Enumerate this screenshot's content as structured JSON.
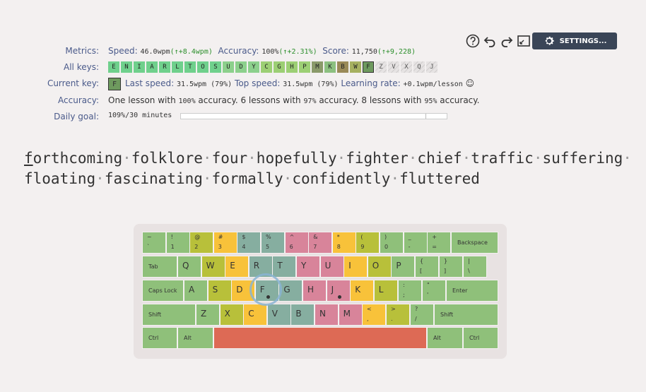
{
  "toolbar": {
    "icons": [
      "help-icon",
      "undo-icon",
      "redo-icon",
      "fullscreen-icon"
    ],
    "settings_label": "SETTINGS..."
  },
  "metrics": {
    "label": "Metrics:",
    "speed_label": "Speed:",
    "speed_value": "46.0wpm",
    "speed_delta": "(↑+8.4wpm)",
    "accuracy_label": "Accuracy:",
    "accuracy_value": "100%",
    "accuracy_delta": "(↑+2.31%)",
    "score_label": "Score:",
    "score_value": "11,750",
    "score_delta": "(↑+9,228)"
  },
  "all_keys": {
    "label": "All keys:",
    "keys": [
      {
        "k": "E",
        "color": "#6fd08c"
      },
      {
        "k": "N",
        "color": "#6fd08c"
      },
      {
        "k": "I",
        "color": "#6fd08c"
      },
      {
        "k": "A",
        "color": "#6fd08c"
      },
      {
        "k": "R",
        "color": "#6fd08c"
      },
      {
        "k": "L",
        "color": "#6fd08c"
      },
      {
        "k": "T",
        "color": "#6fd08c"
      },
      {
        "k": "O",
        "color": "#6fd08c"
      },
      {
        "k": "S",
        "color": "#6fd08c"
      },
      {
        "k": "U",
        "color": "#8cd08c"
      },
      {
        "k": "D",
        "color": "#8cd08c"
      },
      {
        "k": "Y",
        "color": "#8cd08c"
      },
      {
        "k": "C",
        "color": "#9ccf74"
      },
      {
        "k": "G",
        "color": "#9ccf74"
      },
      {
        "k": "H",
        "color": "#9ccf74"
      },
      {
        "k": "P",
        "color": "#9ccf74"
      },
      {
        "k": "M",
        "color": "#8a9a6a"
      },
      {
        "k": "K",
        "color": "#8cc080"
      },
      {
        "k": "B",
        "color": "#9a8a58"
      },
      {
        "k": "W",
        "color": "#a6b060"
      },
      {
        "k": "F",
        "color": "#6e9a5e",
        "current": true
      },
      {
        "k": "Z",
        "hatch": true
      },
      {
        "k": "V",
        "hatch": true
      },
      {
        "k": "X",
        "hatch": true
      },
      {
        "k": "Q",
        "hatch": true
      },
      {
        "k": "J",
        "hatch": true
      }
    ]
  },
  "current_key": {
    "label": "Current key:",
    "key": "F",
    "last_speed_label": "Last speed:",
    "last_speed_value": "31.5wpm (79%)",
    "top_speed_label": "Top speed:",
    "top_speed_value": "31.5wpm (79%)",
    "learning_rate_label": "Learning rate:",
    "learning_rate_value": "+0.1wpm/lesson",
    "smile": "☺"
  },
  "accuracy_row": {
    "label": "Accuracy:",
    "p1": "One lesson with ",
    "v1": "100%",
    "p2": " accuracy. 6 lessons with ",
    "v2": "97%",
    "p3": " accuracy. 8 lessons with ",
    "v3": "95%",
    "p4": " accuracy."
  },
  "daily_goal": {
    "label": "Daily goal:",
    "value": "109%/30 minutes",
    "progress": 0.92
  },
  "lesson": {
    "line1": [
      "forthcoming",
      "folklore",
      "four",
      "hopefully",
      "fighter",
      "chief",
      "traffic",
      "suffering"
    ],
    "line2": [
      "floating",
      "fascinating",
      "formally",
      "confidently",
      "fluttered"
    ],
    "separator": "·"
  },
  "keyboard": {
    "colors": {
      "green": "#8fc07a",
      "yellow": "#b8c03a",
      "orange": "#f8c23a",
      "teal": "#86aea0",
      "pink": "#d8849a",
      "space": "#dd6a55"
    },
    "row1": [
      {
        "top": "~",
        "bot": "`"
      },
      {
        "top": "!",
        "bot": "1"
      },
      {
        "top": "@",
        "bot": "2"
      },
      {
        "top": "#",
        "bot": "3"
      },
      {
        "top": "$",
        "bot": "4"
      },
      {
        "top": "%",
        "bot": "5"
      },
      {
        "top": "^",
        "bot": "6"
      },
      {
        "top": "&",
        "bot": "7"
      },
      {
        "top": "*",
        "bot": "8"
      },
      {
        "top": "(",
        "bot": "9"
      },
      {
        "top": ")",
        "bot": "0"
      },
      {
        "top": "_",
        "bot": "-"
      },
      {
        "top": "+",
        "bot": "="
      }
    ],
    "backspace": "Backspace",
    "tab": "Tab",
    "row2": [
      "Q",
      "W",
      "E",
      "R",
      "T",
      "Y",
      "U",
      "I",
      "O",
      "P"
    ],
    "row2_extra": [
      {
        "top": "{",
        "bot": "["
      },
      {
        "top": "}",
        "bot": "]"
      },
      {
        "top": "|",
        "bot": "\\"
      }
    ],
    "caps": "Caps Lock",
    "row3": [
      "A",
      "S",
      "D",
      "F",
      "G",
      "H",
      "J",
      "K",
      "L"
    ],
    "row3_extra": [
      {
        "top": ":",
        "bot": ";"
      },
      {
        "top": "\"",
        "bot": "'"
      }
    ],
    "enter": "Enter",
    "shift_left": "Shift",
    "row4": [
      "Z",
      "X",
      "C",
      "V",
      "B",
      "N",
      "M"
    ],
    "row4_extra": [
      {
        "top": "<",
        "bot": ","
      },
      {
        "top": ">",
        "bot": "."
      },
      {
        "top": "?",
        "bot": "/"
      }
    ],
    "shift_right": "Shift",
    "ctrl_left": "Ctrl",
    "alt_left": "Alt",
    "alt_right": "Alt",
    "ctrl_right": "Ctrl"
  }
}
